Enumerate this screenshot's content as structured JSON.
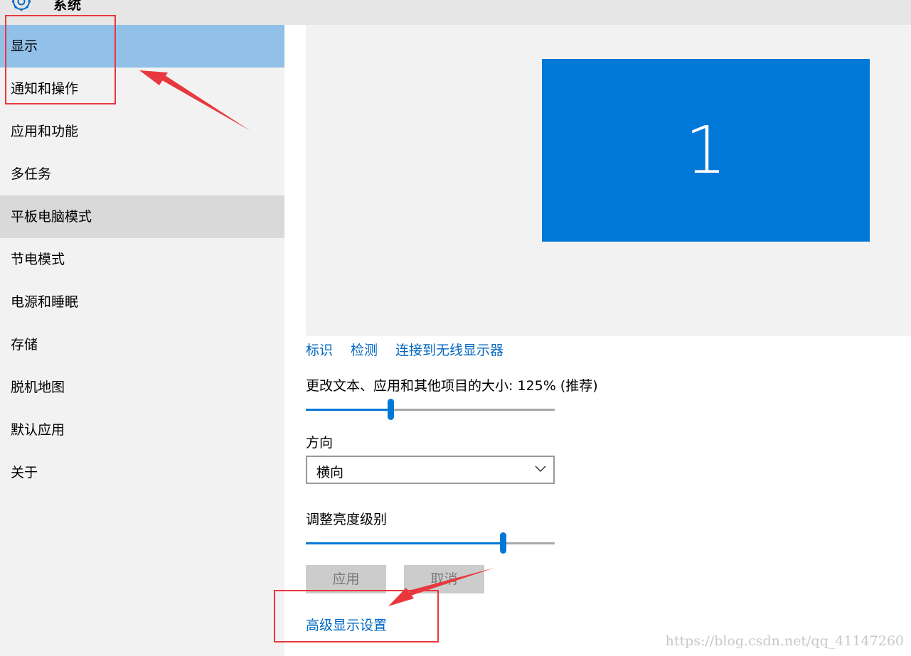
{
  "window": {
    "title": "系统",
    "icon": "gear-icon"
  },
  "sidebar": {
    "items": [
      {
        "label": "显示",
        "state": "selected"
      },
      {
        "label": "通知和操作"
      },
      {
        "label": "应用和功能"
      },
      {
        "label": "多任务"
      },
      {
        "label": "平板电脑模式",
        "state": "hover"
      },
      {
        "label": "节电模式"
      },
      {
        "label": "电源和睡眠"
      },
      {
        "label": "存储"
      },
      {
        "label": "脱机地图"
      },
      {
        "label": "默认应用"
      },
      {
        "label": "关于"
      }
    ]
  },
  "main": {
    "monitor_number": "1",
    "links": {
      "identify": "标识",
      "detect": "检测",
      "wireless": "连接到无线显示器"
    },
    "scale": {
      "label": "更改文本、应用和其他项目的大小: 125% (推荐)",
      "value_fraction": 0.34
    },
    "orientation": {
      "label": "方向",
      "value": "横向"
    },
    "brightness": {
      "label": "调整亮度级别",
      "value_fraction": 0.79
    },
    "buttons": {
      "apply": "应用",
      "cancel": "取消"
    },
    "advanced_link": "高级显示设置"
  },
  "annotations": {
    "color": "#e8383d"
  },
  "watermark": "https://blog.csdn.net/qq_41147260",
  "colors": {
    "accent": "#0078d7",
    "link": "#0067c0",
    "selected": "#91c0e8",
    "sidebar": "#f2f2f2"
  }
}
